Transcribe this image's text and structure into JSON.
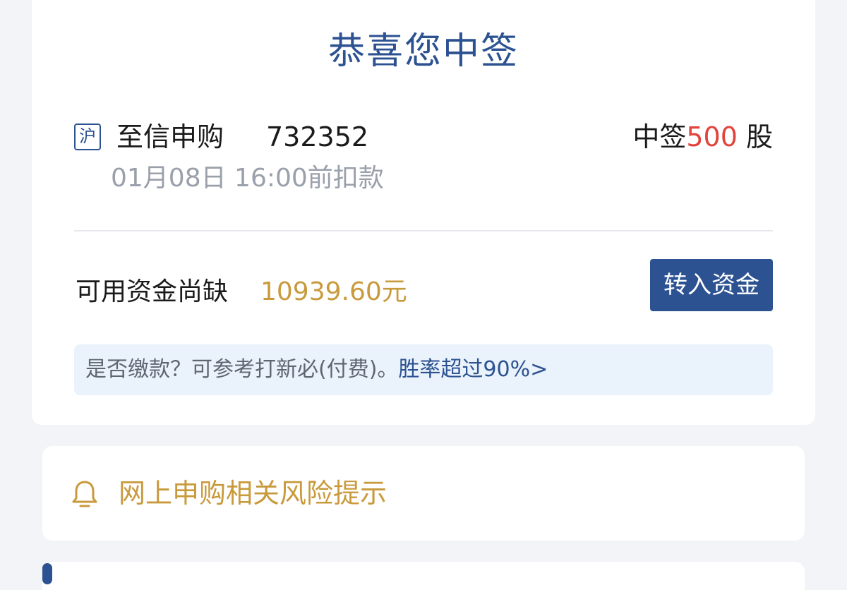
{
  "header": {
    "title": "恭喜您中签"
  },
  "stock": {
    "market_badge": "沪",
    "name": "至信申购",
    "code": "732352",
    "win_prefix": "中签",
    "win_count": "500",
    "win_unit": " 股",
    "deadline": "01月08日 16:00前扣款"
  },
  "funds": {
    "shortfall_label": "可用资金尚缺",
    "shortfall_amount": "10939.60元",
    "transfer_button": "转入资金"
  },
  "tip": {
    "question": "是否缴款？可参考打新必(付费)。",
    "link": "胜率超过90%>"
  },
  "risk": {
    "label": "网上申购相关风险提示",
    "icon": "bell-icon"
  },
  "colors": {
    "primary": "#2c5291",
    "accent_red": "#e0443d",
    "accent_gold": "#c99a3c",
    "muted": "#9aa0ab"
  }
}
